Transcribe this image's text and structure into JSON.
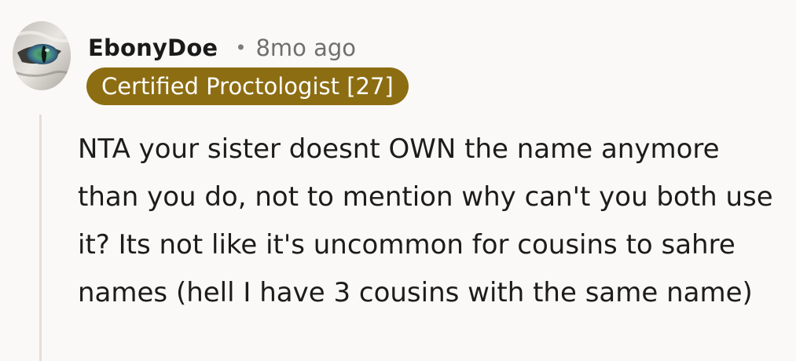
{
  "comment": {
    "author": "EbonyDoe",
    "separator": "•",
    "timestamp": "8mo ago",
    "flair": "Certified Proctologist [27]",
    "body": "NTA your sister doesnt OWN the name anymore than you do, not to mention why can't you both use it? Its not like it's uncommon for cousins to sahre names (hell I have 3 cousins with the same name)"
  },
  "colors": {
    "background": "#faf9f7",
    "flair_background": "#8c6d12",
    "flair_text": "#ffffff",
    "username": "#1a1a1b",
    "timestamp": "#6f6f6f",
    "body_text": "#1c1c1c",
    "thread_line": "#e6ddd8"
  },
  "icons": {
    "avatar": "cat-eye-avatar-icon"
  }
}
